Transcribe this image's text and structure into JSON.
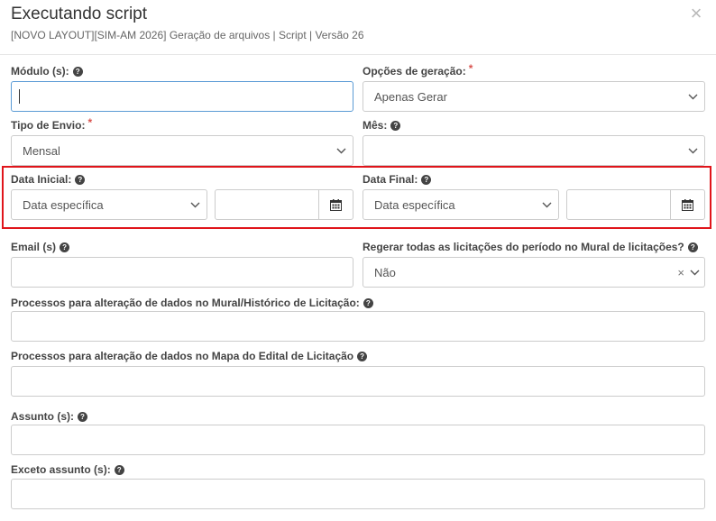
{
  "dialog": {
    "title": "Executando script",
    "subtitle": "[NOVO LAYOUT][SIM-AM 2026] Geração de arquivos | Script | Versão 26",
    "close_symbol": "×"
  },
  "help_symbol": "?",
  "required_symbol": "*",
  "fields": {
    "modulos": {
      "label": "Módulo (s):",
      "value": ""
    },
    "opcoes_geracao": {
      "label": "Opções de geração:",
      "value": "Apenas Gerar"
    },
    "tipo_envio": {
      "label": "Tipo de Envio:",
      "value": "Mensal"
    },
    "mes": {
      "label": "Mês:",
      "value": ""
    },
    "data_inicial": {
      "label": "Data Inicial:",
      "mode": "Data específica",
      "date": ""
    },
    "data_final": {
      "label": "Data Final:",
      "mode": "Data específica",
      "date": ""
    },
    "email": {
      "label": "Email (s)",
      "value": ""
    },
    "regerar": {
      "label": "Regerar todas as licitações do período no Mural de licitações?",
      "value": "Não",
      "clear_symbol": "×"
    },
    "processos_mural": {
      "label": "Processos para alteração de dados no Mural/Histórico de Licitação:",
      "value": ""
    },
    "processos_mapa": {
      "label": "Processos para alteração de dados no Mapa do Edital de Licitação",
      "value": ""
    },
    "assunto": {
      "label": "Assunto (s):",
      "value": ""
    },
    "exceto_assunto": {
      "label": "Exceto assunto (s):",
      "value": ""
    }
  },
  "colors": {
    "highlight": "#e0151b",
    "focus_border": "#5b9bd5",
    "required": "#d9534f"
  }
}
